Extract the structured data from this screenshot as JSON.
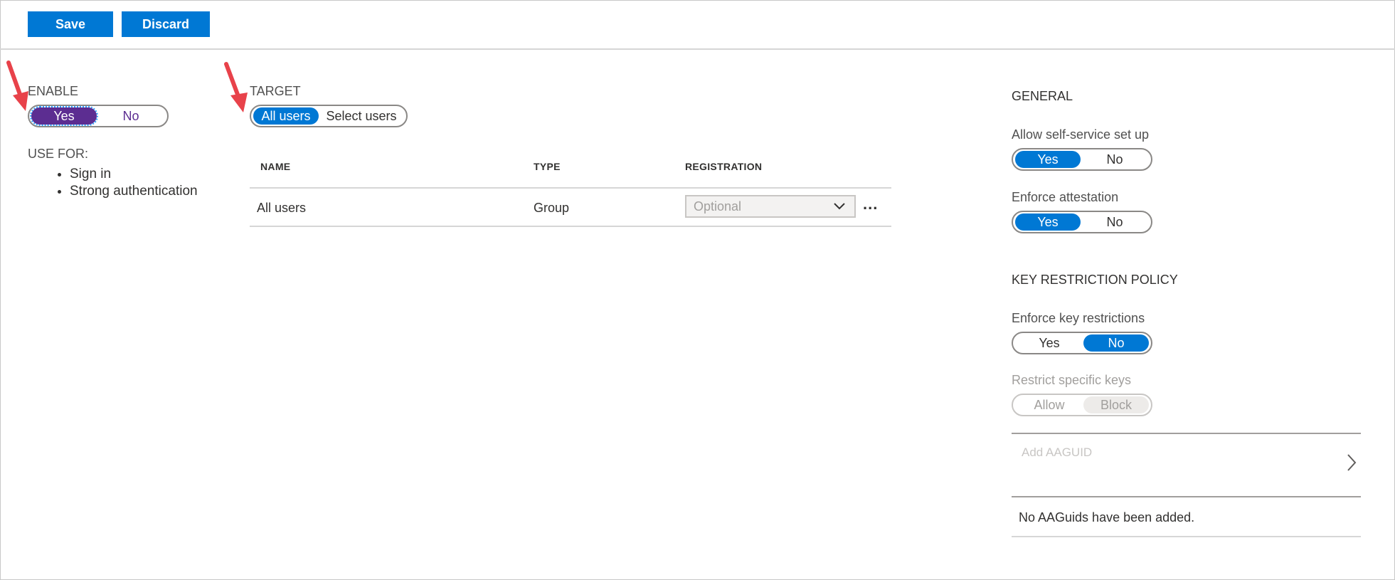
{
  "toolbar": {
    "save_label": "Save",
    "discard_label": "Discard"
  },
  "enable": {
    "label": "ENABLE",
    "options": [
      "Yes",
      "No"
    ],
    "selected": "Yes"
  },
  "use_for": {
    "label": "USE FOR:",
    "items": [
      "Sign in",
      "Strong authentication"
    ]
  },
  "target": {
    "label": "TARGET",
    "options": [
      "All users",
      "Select users"
    ],
    "selected": "All users"
  },
  "table": {
    "headers": [
      "NAME",
      "TYPE",
      "REGISTRATION"
    ],
    "rows": [
      {
        "name": "All users",
        "type": "Group",
        "registration": "Optional"
      }
    ],
    "more_label": "..."
  },
  "general": {
    "heading": "GENERAL",
    "self_service": {
      "label": "Allow self-service set up",
      "options": [
        "Yes",
        "No"
      ],
      "selected": "Yes"
    },
    "attestation": {
      "label": "Enforce attestation",
      "options": [
        "Yes",
        "No"
      ],
      "selected": "Yes"
    }
  },
  "key_policy": {
    "heading": "KEY RESTRICTION POLICY",
    "enforce": {
      "label": "Enforce key restrictions",
      "options": [
        "Yes",
        "No"
      ],
      "selected": "No"
    },
    "restrict": {
      "label": "Restrict specific keys",
      "options": [
        "Allow",
        "Block"
      ],
      "selected": "Block"
    },
    "add_placeholder": "Add AAGUID",
    "empty_message": "No AAGuids have been added."
  },
  "colors": {
    "accent": "#0078d4",
    "enable_selected": "#5c2d91",
    "annotation_arrow": "#e8424a"
  }
}
